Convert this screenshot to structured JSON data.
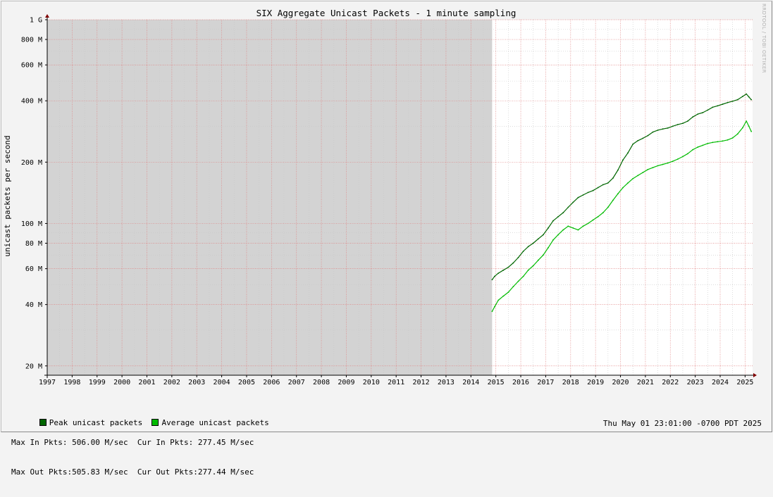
{
  "chart_data": {
    "type": "line",
    "title": "SIX Aggregate Unicast Packets - 1 minute sampling",
    "ylabel": "unicast packets per second",
    "xlabel": "",
    "y_scale": "log",
    "ylim": [
      18000000,
      1000000000
    ],
    "xlim": [
      1997.0,
      2025.3
    ],
    "y_ticks": [
      {
        "value": 20000000,
        "label": "20 M"
      },
      {
        "value": 40000000,
        "label": "40 M"
      },
      {
        "value": 60000000,
        "label": "60 M"
      },
      {
        "value": 80000000,
        "label": "80 M"
      },
      {
        "value": 100000000,
        "label": "100 M"
      },
      {
        "value": 200000000,
        "label": "200 M"
      },
      {
        "value": 400000000,
        "label": "400 M"
      },
      {
        "value": 600000000,
        "label": "600 M"
      },
      {
        "value": 800000000,
        "label": "800 M"
      },
      {
        "value": 1000000000,
        "label": "1 G"
      }
    ],
    "x_ticks": [
      "1997",
      "1998",
      "1999",
      "2000",
      "2001",
      "2002",
      "2003",
      "2004",
      "2005",
      "2006",
      "2007",
      "2008",
      "2009",
      "2010",
      "2011",
      "2012",
      "2013",
      "2014",
      "2015",
      "2016",
      "2017",
      "2018",
      "2019",
      "2020",
      "2021",
      "2022",
      "2023",
      "2024",
      "2025"
    ],
    "no_data_until": 2014.85,
    "grid": true,
    "legend_position": "bottom-left",
    "series": [
      {
        "name": "Peak unicast packets",
        "color": "#006600",
        "x": [
          2014.85,
          2014.95,
          2015.1,
          2015.3,
          2015.5,
          2015.7,
          2015.9,
          2016.1,
          2016.3,
          2016.5,
          2016.7,
          2016.9,
          2017.1,
          2017.3,
          2017.5,
          2017.7,
          2017.9,
          2018.1,
          2018.3,
          2018.5,
          2018.7,
          2018.9,
          2019.1,
          2019.3,
          2019.5,
          2019.7,
          2019.9,
          2020.1,
          2020.3,
          2020.5,
          2020.7,
          2020.9,
          2021.1,
          2021.3,
          2021.5,
          2021.7,
          2021.9,
          2022.1,
          2022.3,
          2022.5,
          2022.7,
          2022.9,
          2023.1,
          2023.3,
          2023.5,
          2023.7,
          2023.9,
          2024.1,
          2024.3,
          2024.5,
          2024.7,
          2024.9,
          2025.05,
          2025.15,
          2025.25
        ],
        "values": [
          53000000,
          55000000,
          57000000,
          59000000,
          61000000,
          64000000,
          68000000,
          73000000,
          77000000,
          80000000,
          84000000,
          88000000,
          95000000,
          103000000,
          108000000,
          113000000,
          120000000,
          127000000,
          134000000,
          138000000,
          142000000,
          145000000,
          150000000,
          155000000,
          158000000,
          167000000,
          183000000,
          205000000,
          222000000,
          245000000,
          255000000,
          262000000,
          270000000,
          281000000,
          287000000,
          291000000,
          294000000,
          300000000,
          306000000,
          310000000,
          318000000,
          333000000,
          344000000,
          350000000,
          360000000,
          372000000,
          378000000,
          385000000,
          392000000,
          398000000,
          405000000,
          420000000,
          432000000,
          418000000,
          405000000
        ]
      },
      {
        "name": "Average unicast packets",
        "color": "#00bb00",
        "x": [
          2014.85,
          2014.95,
          2015.1,
          2015.3,
          2015.5,
          2015.7,
          2015.9,
          2016.1,
          2016.3,
          2016.5,
          2016.7,
          2016.9,
          2017.1,
          2017.3,
          2017.5,
          2017.7,
          2017.9,
          2018.1,
          2018.3,
          2018.5,
          2018.7,
          2018.9,
          2019.1,
          2019.3,
          2019.5,
          2019.7,
          2019.9,
          2020.1,
          2020.3,
          2020.5,
          2020.7,
          2020.9,
          2021.1,
          2021.3,
          2021.5,
          2021.7,
          2021.9,
          2022.1,
          2022.3,
          2022.5,
          2022.7,
          2022.9,
          2023.1,
          2023.3,
          2023.5,
          2023.7,
          2023.9,
          2024.1,
          2024.3,
          2024.5,
          2024.7,
          2024.9,
          2025.05,
          2025.15,
          2025.25
        ],
        "values": [
          37000000,
          39000000,
          42000000,
          44000000,
          46000000,
          49000000,
          52000000,
          55000000,
          59000000,
          62000000,
          66000000,
          70000000,
          76000000,
          83000000,
          88000000,
          93000000,
          97000000,
          95000000,
          93000000,
          97000000,
          100000000,
          104000000,
          108000000,
          113000000,
          120000000,
          130000000,
          140000000,
          150000000,
          158000000,
          166000000,
          172000000,
          178000000,
          184000000,
          188000000,
          192000000,
          195000000,
          198000000,
          202000000,
          207000000,
          213000000,
          220000000,
          230000000,
          237000000,
          242000000,
          247000000,
          250000000,
          252000000,
          254000000,
          257000000,
          263000000,
          275000000,
          295000000,
          318000000,
          300000000,
          283000000
        ]
      }
    ]
  },
  "stats": {
    "max_in": "Max In Pkts: 506.00 M/sec",
    "cur_in": "Cur In Pkts: 277.45 M/sec",
    "max_out": "Max Out Pkts:505.83 M/sec",
    "cur_out": "Cur Out Pkts:277.44 M/sec"
  },
  "timestamp": "Thu May 01 23:01:00 -0700 PDT 2025",
  "watermark": "RRDTOOL / TOBI OETIKER",
  "colors": {
    "background": "#f3f3f3",
    "canvas": "#ffffff",
    "nodata": "#d3d3d3",
    "grid_major": "#e08080",
    "grid_minor": "#c8c8c8",
    "axis": "#800000"
  }
}
